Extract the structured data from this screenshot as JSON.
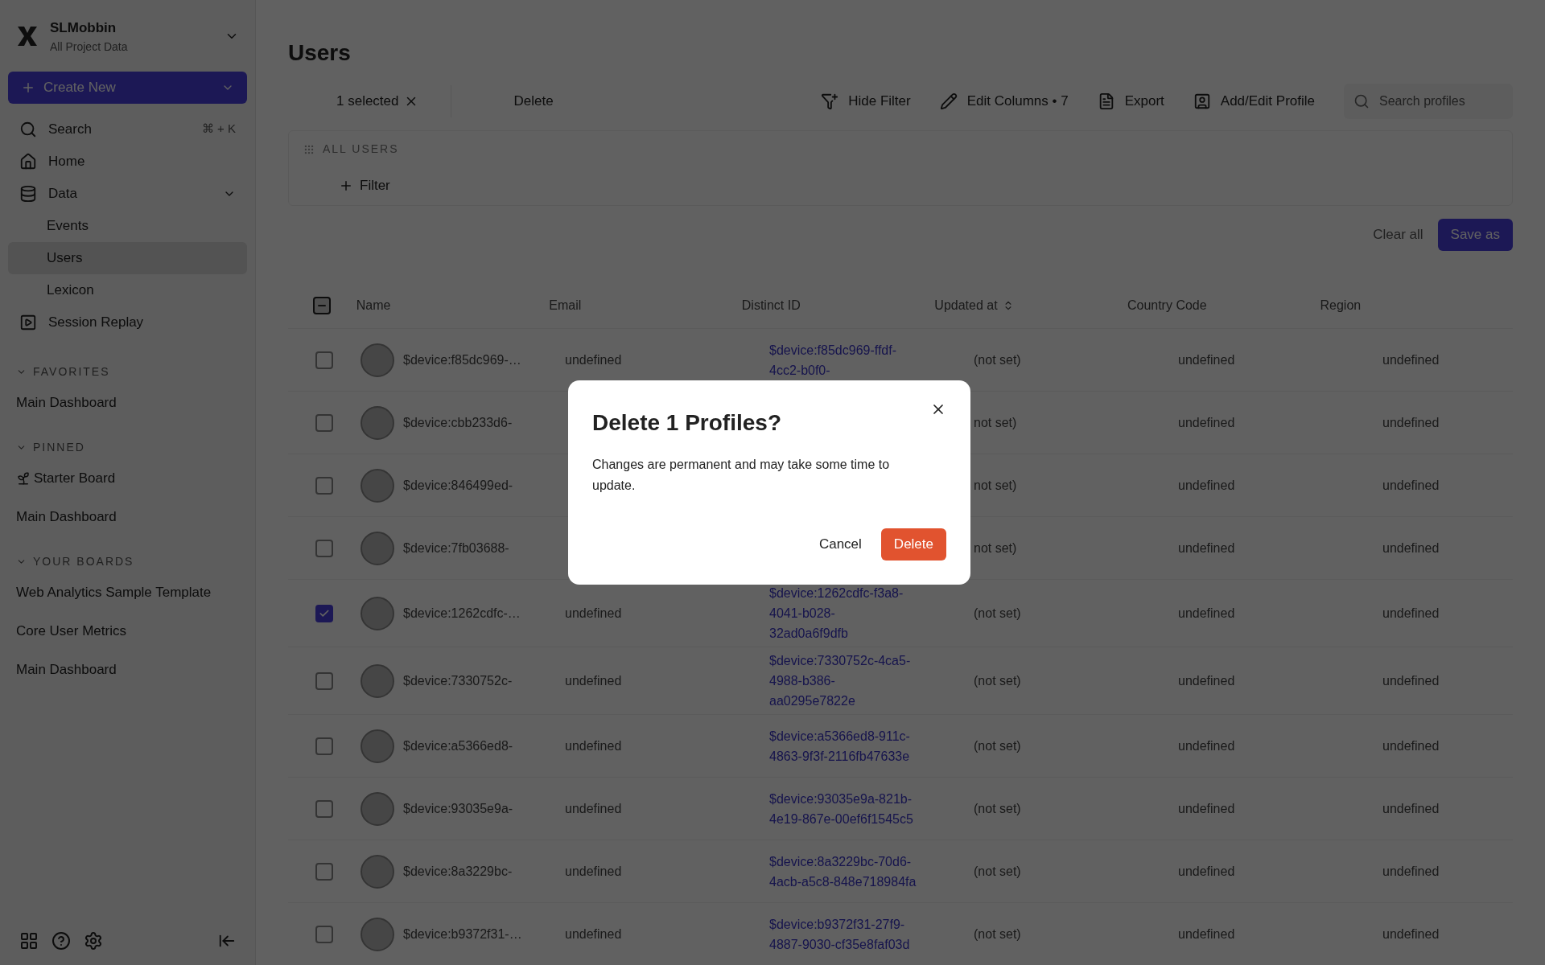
{
  "sidebar": {
    "workspace": {
      "name": "SLMobbin",
      "subtitle": "All Project Data"
    },
    "create_button": "Create New",
    "nav": [
      {
        "kind": "search",
        "label": "Search",
        "shortcut": "⌘ + K"
      },
      {
        "kind": "home",
        "label": "Home"
      },
      {
        "kind": "data",
        "label": "Data",
        "expanded": true,
        "children": [
          {
            "label": "Events",
            "selected": false
          },
          {
            "label": "Users",
            "selected": true
          },
          {
            "label": "Lexicon",
            "selected": false
          }
        ]
      },
      {
        "kind": "replay",
        "label": "Session Replay"
      }
    ],
    "sections": [
      {
        "title": "FAVORITES",
        "expanded": true,
        "items": [
          {
            "kind": "plain",
            "label": "Main Dashboard"
          }
        ]
      },
      {
        "title": "PINNED",
        "expanded": true,
        "items": [
          {
            "kind": "sprout",
            "label": "Starter Board"
          },
          {
            "kind": "plain",
            "label": "Main Dashboard"
          }
        ]
      },
      {
        "title": "YOUR BOARDS",
        "expanded": true,
        "items": [
          {
            "kind": "plain",
            "label": "Web Analytics Sample Template"
          },
          {
            "kind": "plain",
            "label": "Core User Metrics"
          },
          {
            "kind": "plain",
            "label": "Main Dashboard"
          }
        ]
      }
    ]
  },
  "page": {
    "title": "Users"
  },
  "selection_bar": {
    "count": "1 selected",
    "delete": "Delete"
  },
  "actions": [
    {
      "kind": "filter",
      "label": "Hide Filter"
    },
    {
      "kind": "edit",
      "label": "Edit Columns • 7"
    },
    {
      "kind": "export",
      "label": "Export"
    },
    {
      "kind": "profile",
      "label": "Add/Edit Profile"
    }
  ],
  "search": {
    "placeholder": "Search profiles"
  },
  "filter_panel": {
    "title": "ALL USERS",
    "add_filter": "Filter"
  },
  "clear_all": "Clear all",
  "save_as": "Save as",
  "table": {
    "header_checkbox": {
      "indeterminate": true
    },
    "columns": [
      {
        "label": "Name",
        "sortable": false
      },
      {
        "label": "Email",
        "sortable": false
      },
      {
        "label": "Distinct ID",
        "sortable": false
      },
      {
        "label": "Updated at",
        "sortable": true
      },
      {
        "label": "Country Code",
        "sortable": false
      },
      {
        "label": "Region",
        "sortable": false
      }
    ],
    "rows": [
      {
        "checked": false,
        "name": "$device:f85dc969-…",
        "email": "undefined",
        "distinct_id": [
          "$device:f85dc969-ffdf-",
          "4cc2-b0f0-"
        ],
        "updated_at": "(not set)",
        "country_code": "undefined",
        "region": "undefined"
      },
      {
        "checked": false,
        "name": "$device:cbb233d6-",
        "updated_at": "not set)",
        "country_code": "undefined",
        "region": "undefined"
      },
      {
        "checked": false,
        "name": "$device:846499ed-",
        "updated_at": "not set)",
        "country_code": "undefined",
        "region": "undefined"
      },
      {
        "checked": false,
        "name": "$device:7fb03688-",
        "updated_at": "not set)",
        "country_code": "undefined",
        "region": "undefined"
      },
      {
        "checked": true,
        "name": "$device:1262cdfc-…",
        "email": "undefined",
        "distinct_id": [
          "$device:1262cdfc-f3a8-",
          "4041-b028-",
          "32ad0a6f9dfb"
        ],
        "updated_at": "(not set)",
        "country_code": "undefined",
        "region": "undefined"
      },
      {
        "checked": false,
        "name": "$device:7330752c-",
        "email": "undefined",
        "distinct_id": [
          "$device:7330752c-4ca5-",
          "4988-b386-",
          "aa0295e7822e"
        ],
        "updated_at": "(not set)",
        "country_code": "undefined",
        "region": "undefined"
      },
      {
        "checked": false,
        "name": "$device:a5366ed8-",
        "email": "undefined",
        "distinct_id": [
          "$device:a5366ed8-911c-",
          "4863-9f3f-2116fb47633e"
        ],
        "updated_at": "(not set)",
        "country_code": "undefined",
        "region": "undefined"
      },
      {
        "checked": false,
        "name": "$device:93035e9a-",
        "email": "undefined",
        "distinct_id": [
          "$device:93035e9a-821b-",
          "4e19-867e-00ef6f1545c5"
        ],
        "updated_at": "(not set)",
        "country_code": "undefined",
        "region": "undefined"
      },
      {
        "checked": false,
        "name": "$device:8a3229bc-",
        "email": "undefined",
        "distinct_id": [
          "$device:8a3229bc-70d6-",
          "4acb-a5c8-848e718984fa"
        ],
        "updated_at": "(not set)",
        "country_code": "undefined",
        "region": "undefined"
      },
      {
        "checked": false,
        "name": "$device:b9372f31-…",
        "email": "undefined",
        "distinct_id": [
          "$device:b9372f31-27f9-",
          "4887-9030-cf35e8faf03d"
        ],
        "updated_at": "(not set)",
        "country_code": "undefined",
        "region": "undefined"
      }
    ]
  },
  "dialog": {
    "title": "Delete 1 Profiles?",
    "message": "Changes are permanent and may take some time to update.",
    "cancel": "Cancel",
    "confirm": "Delete"
  }
}
